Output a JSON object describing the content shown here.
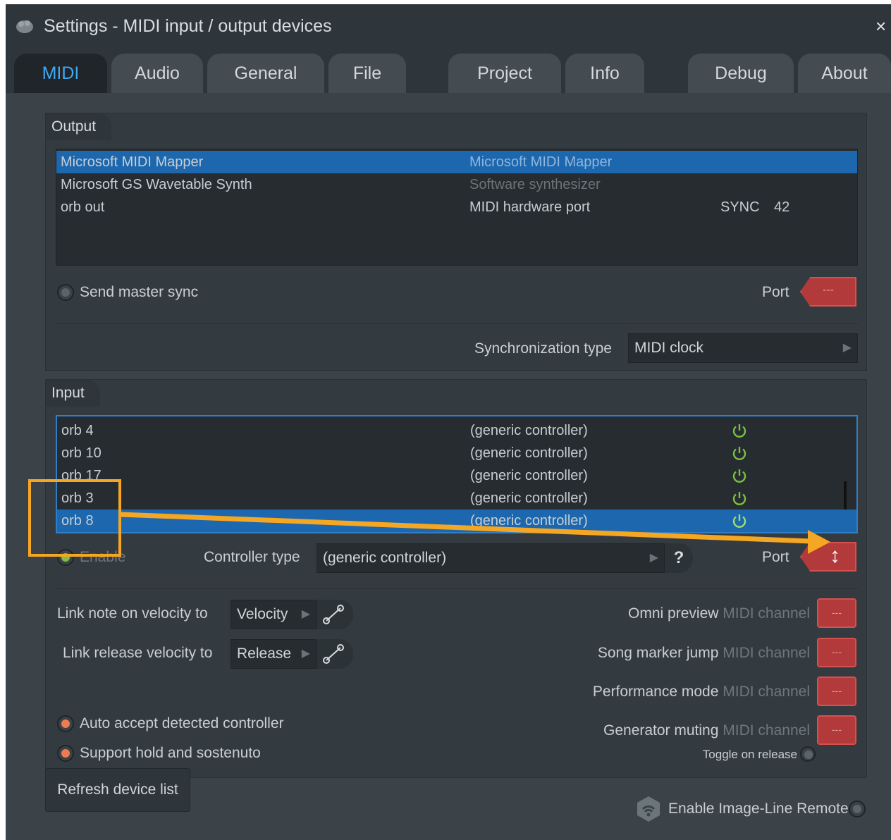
{
  "window": {
    "title": "Settings - MIDI input / output devices",
    "close_glyph": "×"
  },
  "tabs": [
    {
      "label": "MIDI",
      "active": true
    },
    {
      "label": "Audio"
    },
    {
      "label": "General"
    },
    {
      "label": "File"
    },
    {
      "label": "Project"
    },
    {
      "label": "Info"
    },
    {
      "label": "Debug"
    },
    {
      "label": "About"
    }
  ],
  "output": {
    "label": "Output",
    "devices": [
      {
        "name": "Microsoft MIDI Mapper",
        "type": "Microsoft MIDI Mapper",
        "selected": true
      },
      {
        "name": "Microsoft GS Wavetable Synth",
        "type": "Software synthesizer"
      },
      {
        "name": "orb out",
        "type": "MIDI hardware port",
        "sync": "SYNC",
        "port": "42"
      }
    ],
    "send_master_sync": "Send master sync",
    "port_label": "Port",
    "port_value": "---",
    "sync_type_label": "Synchronization type",
    "sync_type_value": "MIDI clock"
  },
  "input": {
    "label": "Input",
    "devices": [
      {
        "name": "orb 4",
        "type": "(generic controller)"
      },
      {
        "name": "orb 10",
        "type": "(generic controller)"
      },
      {
        "name": "orb 17",
        "type": "(generic controller)"
      },
      {
        "name": "orb 3",
        "type": "(generic controller)"
      },
      {
        "name": "orb 8",
        "type": "(generic controller)",
        "selected": true
      }
    ],
    "enable_label": "Enable",
    "controller_type_label": "Controller type",
    "controller_type_value": "(generic controller)",
    "help": "?",
    "port_label": "Port"
  },
  "links": {
    "note_on_label": "Link note on velocity to",
    "note_on_value": "Velocity",
    "release_label": "Link release velocity to",
    "release_value": "Release"
  },
  "channels": [
    {
      "bold": "Omni preview",
      "dim": "MIDI channel",
      "value": "---"
    },
    {
      "bold": "Song marker jump",
      "dim": "MIDI channel",
      "value": "---"
    },
    {
      "bold": "Performance mode",
      "dim": "MIDI channel",
      "value": "---"
    },
    {
      "bold": "Generator muting",
      "dim": "MIDI channel",
      "value": "---"
    }
  ],
  "toggle_on_release": "Toggle on release",
  "options": {
    "auto_accept": "Auto accept detected controller",
    "hold_sostenuto": "Support hold and sostenuto"
  },
  "refresh_label": "Refresh device list",
  "remote_label": "Enable Image-Line Remote",
  "colors": {
    "accent": "#3fa9f5",
    "selection": "#1c67ad",
    "annotation": "#f5a623",
    "port": "#b23a3a"
  }
}
